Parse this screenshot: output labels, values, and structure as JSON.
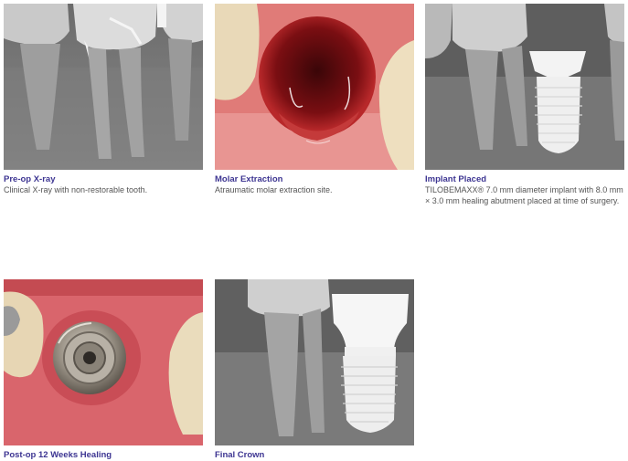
{
  "cards": [
    {
      "title": "Pre-op X-ray",
      "description": "Clinical X-ray with non-restorable tooth.",
      "image": "pre-op-xray"
    },
    {
      "title": "Molar Extraction",
      "description": "Atraumatic molar extraction site.",
      "image": "extraction-site-photo"
    },
    {
      "title": "Implant Placed",
      "description": "TILOBEMAXX® 7.0 mm diameter implant with 8.0 mm × 3.0 mm healing abutment placed at time of surgery.",
      "image": "implant-xray"
    },
    {
      "title": "Post-op 12 Weeks Healing",
      "description": "",
      "image": "healing-abutment-photo"
    },
    {
      "title": "Final Crown",
      "description": "",
      "image": "final-crown-xray"
    }
  ],
  "colors": {
    "title": "#3d3592",
    "description": "#555555"
  }
}
